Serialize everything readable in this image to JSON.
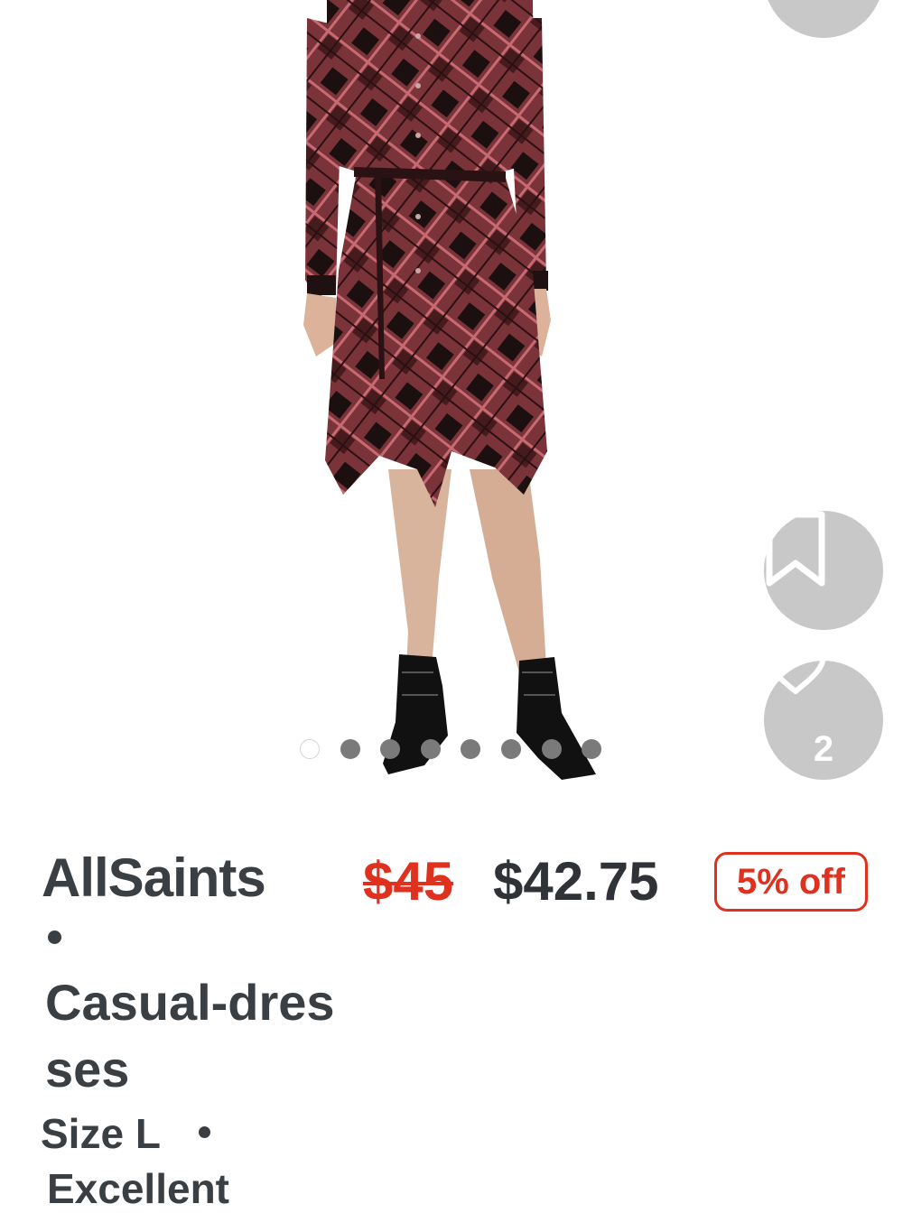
{
  "product": {
    "brand": "AllSaints",
    "category": "Casual-dresses",
    "size": "Size L",
    "condition": "Excellent"
  },
  "pricing": {
    "original_price": "$45",
    "sale_price": "$42.75",
    "discount_label": "5% off",
    "accent_color": "#e0301e"
  },
  "gallery": {
    "image_count": 8,
    "active_index": 0
  },
  "actions": {
    "share_icon": "share-icon",
    "save_icon": "bookmark-icon",
    "like_icon": "heart-icon",
    "like_count": "2"
  }
}
